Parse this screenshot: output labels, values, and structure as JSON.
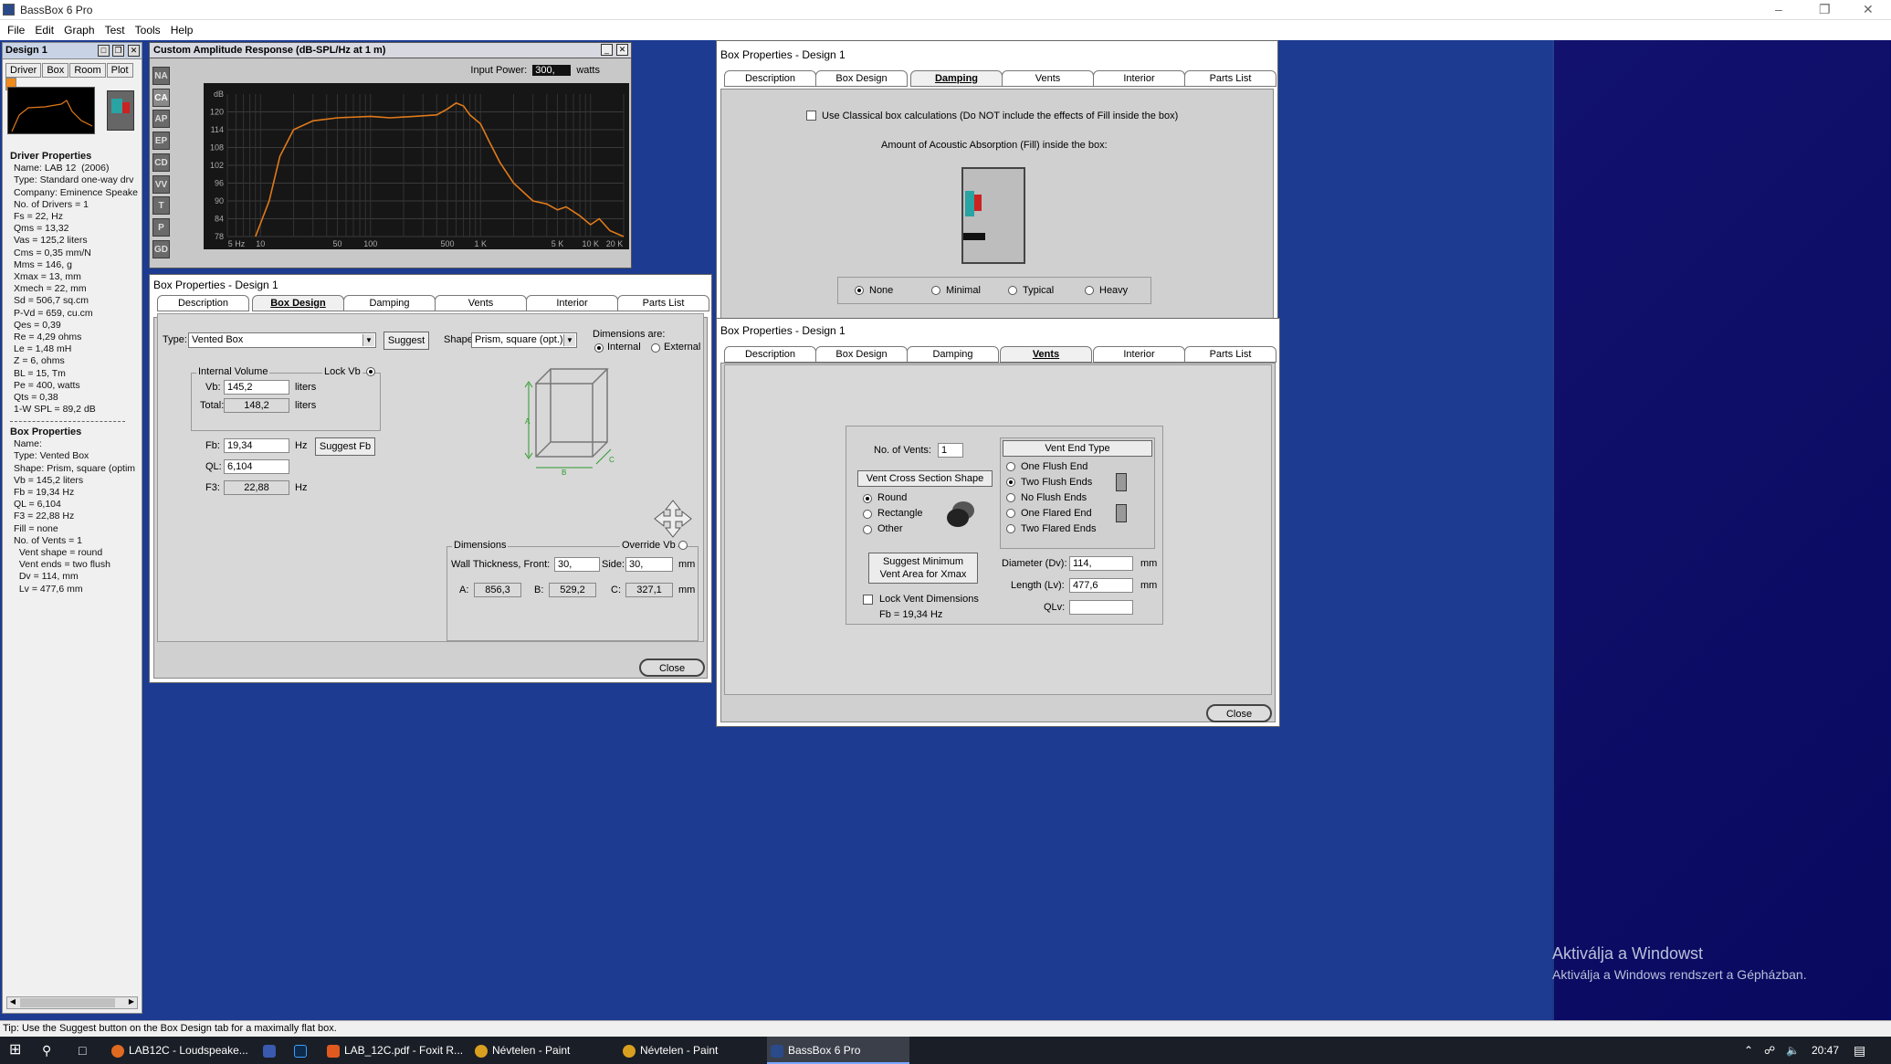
{
  "app": {
    "title": "BassBox 6 Pro"
  },
  "menu": [
    "File",
    "Edit",
    "Graph",
    "Test",
    "Tools",
    "Help"
  ],
  "left_panel": {
    "title": "Design 1",
    "tabs": [
      "Driver",
      "Box",
      "Room",
      "Plot"
    ],
    "driver_header": "Driver Properties",
    "driver_props": [
      "Name: LAB 12  (2006)",
      "Type: Standard one-way drv",
      "Company: Eminence Speake",
      "No. of Drivers = 1",
      "Fs = 22, Hz",
      "Qms = 13,32",
      "Vas = 125,2 liters",
      "Cms = 0,35 mm/N",
      "Mms = 146, g",
      "Xmax = 13, mm",
      "Xmech = 22, mm",
      "Sd = 506,7 sq.cm",
      "P-Vd = 659, cu.cm",
      "Qes = 0,39",
      "Re = 4,29 ohms",
      "Le = 1,48 mH",
      "Z = 6, ohms",
      "BL = 15, Tm",
      "Pe = 400, watts",
      "Qts = 0,38",
      "1-W SPL = 89,2 dB"
    ],
    "box_header": "Box Properties",
    "box_props": [
      "Name:",
      "Type: Vented Box",
      "Shape: Prism, square (optim",
      "Vb = 145,2 liters",
      "Fb = 19,34 Hz",
      "QL = 6,104",
      "F3 = 22,88 Hz",
      "Fill = none",
      "No. of Vents = 1",
      "  Vent shape = round",
      "  Vent ends = two flush",
      "  Dv = 114, mm",
      "  Lv = 477,6 mm"
    ]
  },
  "chart": {
    "title": "Custom Amplitude Response (dB-SPL/Hz at 1 m)",
    "input_power_label": "Input Power:",
    "input_power_value": "300,",
    "input_power_unit": "watts",
    "side_buttons": [
      "NA",
      "CA",
      "AP",
      "EP",
      "CD",
      "VV",
      "T",
      "P",
      "GD"
    ]
  },
  "chart_data": {
    "type": "line",
    "title": "Custom Amplitude Response (dB-SPL/Hz at 1 m)",
    "xscale": "log",
    "x_ticks": [
      "5 Hz",
      "10",
      "50",
      "100",
      "500",
      "1 K",
      "5 K",
      "10 K",
      "20 K"
    ],
    "y_ticks": [
      "dB",
      "120",
      "114",
      "108",
      "102",
      "96",
      "90",
      "84",
      "78"
    ],
    "ylim": [
      78,
      126
    ],
    "xlim": [
      5,
      20000
    ],
    "series": [
      {
        "color": "#e07a1a",
        "points": [
          [
            9,
            78
          ],
          [
            12,
            90
          ],
          [
            15,
            105
          ],
          [
            20,
            114
          ],
          [
            30,
            117
          ],
          [
            50,
            118
          ],
          [
            100,
            118.5
          ],
          [
            150,
            118
          ],
          [
            250,
            118.5
          ],
          [
            400,
            119
          ],
          [
            500,
            121
          ],
          [
            600,
            123
          ],
          [
            700,
            122
          ],
          [
            800,
            119
          ],
          [
            1000,
            116
          ],
          [
            1200,
            110
          ],
          [
            1500,
            103
          ],
          [
            2000,
            96
          ],
          [
            3000,
            90
          ],
          [
            4000,
            89
          ],
          [
            5000,
            87
          ],
          [
            6000,
            88
          ],
          [
            8000,
            85
          ],
          [
            10000,
            82
          ],
          [
            12000,
            84
          ],
          [
            15000,
            80
          ],
          [
            20000,
            78
          ]
        ]
      }
    ]
  },
  "box_dialog1": {
    "title": "Box Properties - Design 1",
    "tabs": [
      "Description",
      "Box Design",
      "Damping",
      "Vents",
      "Interior",
      "Parts List"
    ],
    "type_label": "Type:",
    "type_value": "Vented Box",
    "suggest": "Suggest",
    "shape_label": "Shape:",
    "shape_value": "Prism, square (opt.)",
    "dims_are": "Dimensions are:",
    "internal": "Internal",
    "external": "External",
    "internal_volume": "Internal Volume",
    "lock_vb": "Lock Vb",
    "vb_label": "Vb:",
    "vb_value": "145,2",
    "vb_unit": "liters",
    "total_label": "Total:",
    "total_value": "148,2",
    "total_unit": "liters",
    "fb_label": "Fb:",
    "fb_value": "19,34",
    "fb_unit": "Hz",
    "suggest_fb": "Suggest Fb",
    "ql_label": "QL:",
    "ql_value": "6,104",
    "f3_label": "F3:",
    "f3_value": "22,88",
    "f3_unit": "Hz",
    "dimensions": "Dimensions",
    "override_vb": "Override Vb",
    "wall_label": "Wall Thickness, Front:",
    "wall_front": "30,",
    "side_label": "Side:",
    "side_value": "30,",
    "mm": "mm",
    "a_label": "A:",
    "a_value": "856,3",
    "b_label": "B:",
    "b_value": "529,2",
    "c_label": "C:",
    "c_value": "327,1",
    "close": "Close",
    "dim_letters": [
      "A",
      "B",
      "C"
    ]
  },
  "damping_dialog": {
    "title": "Box Properties - Design 1",
    "tabs": [
      "Description",
      "Box Design",
      "Damping",
      "Vents",
      "Interior",
      "Parts List"
    ],
    "classical": "Use Classical box calculations (Do NOT include the effects of Fill inside the box)",
    "amount": "Amount of Acoustic Absorption (Fill) inside the box:",
    "options": [
      "None",
      "Minimal",
      "Typical",
      "Heavy"
    ]
  },
  "vents_dialog": {
    "title": "Box Properties - Design 1",
    "tabs": [
      "Description",
      "Box Design",
      "Damping",
      "Vents",
      "Interior",
      "Parts List"
    ],
    "num_vents_label": "No. of Vents:",
    "num_vents": "1",
    "cross_section": "Vent Cross Section Shape",
    "shapes": [
      "Round",
      "Rectangle",
      "Other"
    ],
    "end_type": "Vent End Type",
    "ends": [
      "One Flush End",
      "Two Flush Ends",
      "No Flush Ends",
      "One Flared End",
      "Two Flared Ends"
    ],
    "suggest_min": "Suggest Minimum",
    "suggest_min2": "Vent Area for Xmax",
    "lock_dims": "Lock Vent Dimensions",
    "fb_text": "Fb = 19,34 Hz",
    "dv_label": "Diameter (Dv):",
    "dv_value": "114,",
    "lv_label": "Length (Lv):",
    "lv_value": "477,6",
    "qlv_label": "QLv:",
    "mm": "mm",
    "close": "Close"
  },
  "status": "Tip: Use the Suggest button on the Box Design tab for a maximally flat box.",
  "watermark": {
    "line1": "Aktiválja a Windowst",
    "line2": "Aktiválja a Windows rendszert a Gépházban."
  },
  "taskbar": {
    "items": [
      "LAB12C - Loudspeake...",
      "LAB_12C.pdf - Foxit R...",
      "Névtelen - Paint",
      "Névtelen - Paint",
      "BassBox 6 Pro"
    ],
    "time": "20:47"
  }
}
